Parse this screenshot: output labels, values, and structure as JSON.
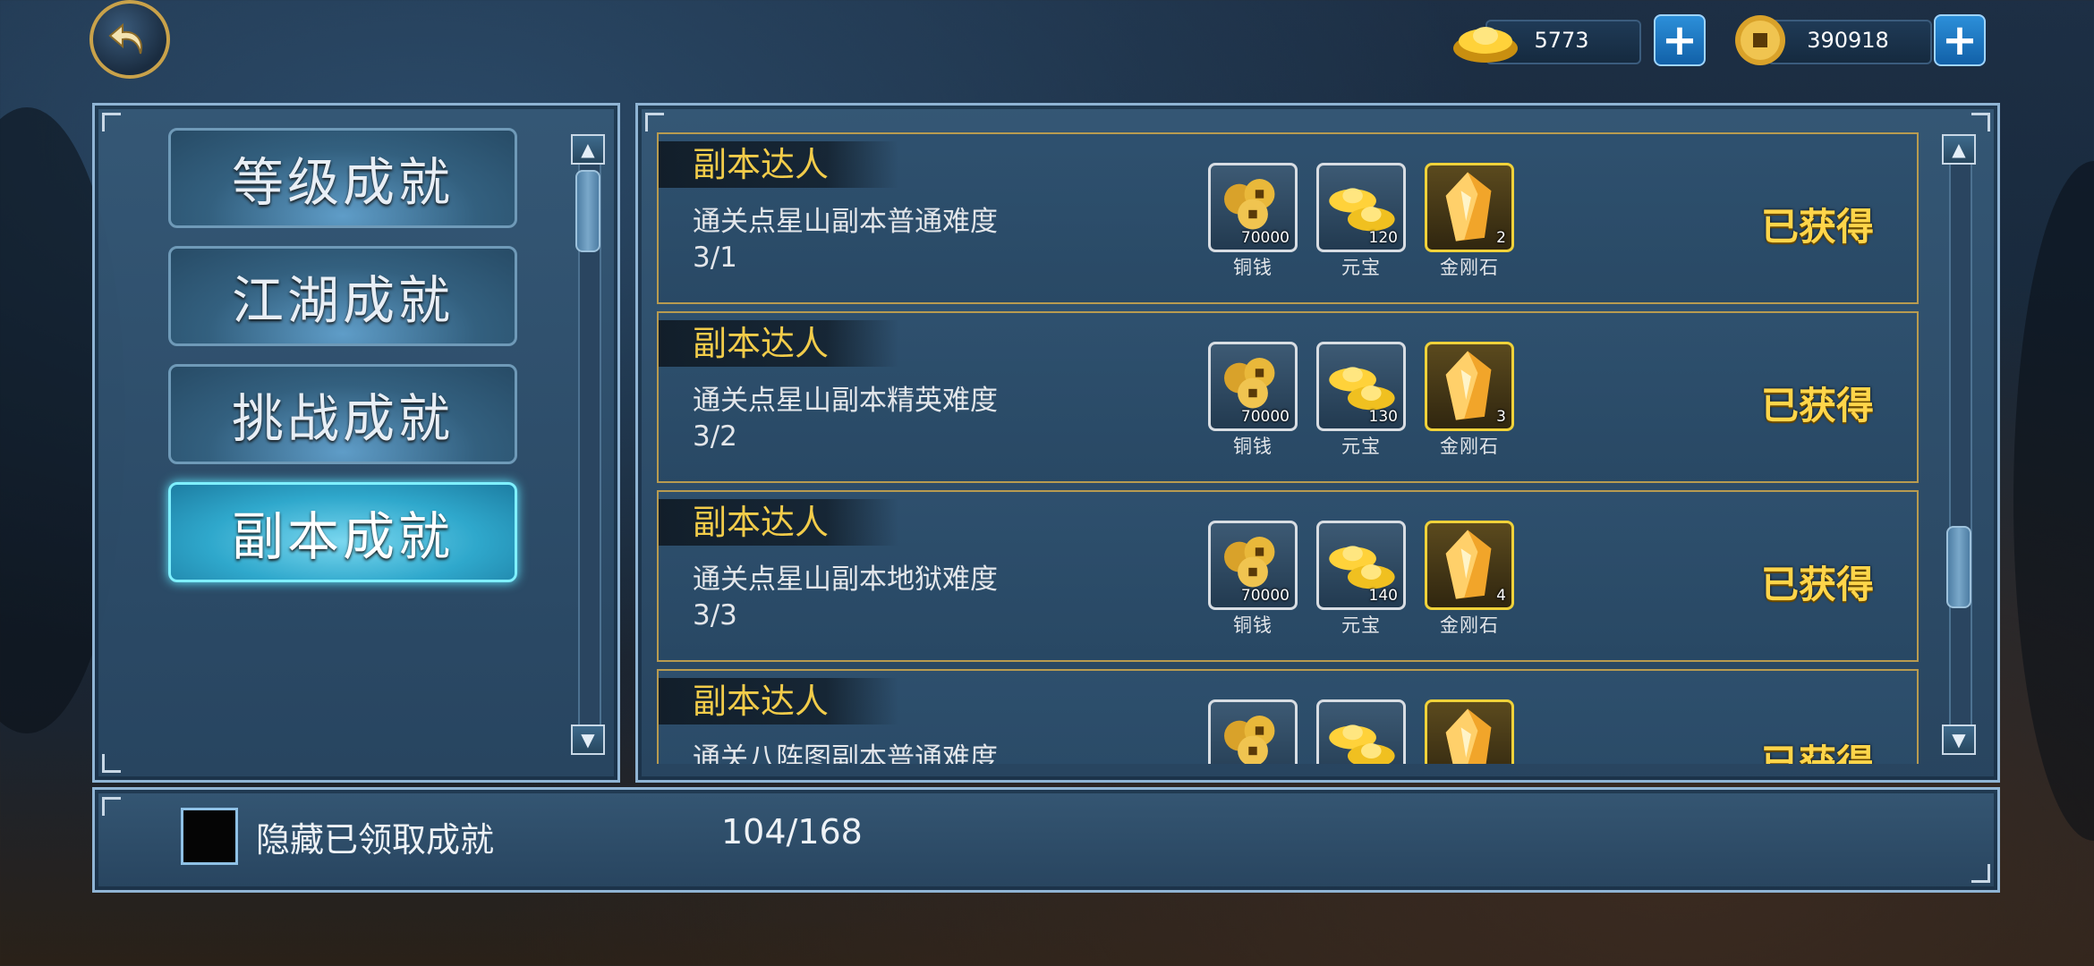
{
  "currencies": [
    {
      "name": "yuanbao",
      "icon": "gold-ingot-icon",
      "value": "5773"
    },
    {
      "name": "tongqian",
      "icon": "copper-coin-icon",
      "value": "390918"
    }
  ],
  "plus_symbol": "+",
  "tabs": [
    {
      "label": "等级成就",
      "active": false
    },
    {
      "label": "江湖成就",
      "active": false
    },
    {
      "label": "挑战成就",
      "active": false
    },
    {
      "label": "副本成就",
      "active": true
    }
  ],
  "achievements": [
    {
      "title": "副本达人",
      "desc": "通关点星山副本普通难度",
      "progress": "3/1",
      "rewards": [
        {
          "name": "铜钱",
          "qty": "70000",
          "icon": "coins-icon"
        },
        {
          "name": "元宝",
          "qty": "120",
          "icon": "gold-ingot-icon"
        },
        {
          "name": "金刚石",
          "qty": "2",
          "icon": "diamond-icon"
        }
      ],
      "status": "已获得"
    },
    {
      "title": "副本达人",
      "desc": "通关点星山副本精英难度",
      "progress": "3/2",
      "rewards": [
        {
          "name": "铜钱",
          "qty": "70000",
          "icon": "coins-icon"
        },
        {
          "name": "元宝",
          "qty": "130",
          "icon": "gold-ingot-icon"
        },
        {
          "name": "金刚石",
          "qty": "3",
          "icon": "diamond-icon"
        }
      ],
      "status": "已获得"
    },
    {
      "title": "副本达人",
      "desc": "通关点星山副本地狱难度",
      "progress": "3/3",
      "rewards": [
        {
          "name": "铜钱",
          "qty": "70000",
          "icon": "coins-icon"
        },
        {
          "name": "元宝",
          "qty": "140",
          "icon": "gold-ingot-icon"
        },
        {
          "name": "金刚石",
          "qty": "4",
          "icon": "diamond-icon"
        }
      ],
      "status": "已获得"
    },
    {
      "title": "副本达人",
      "desc": "通关八阵图副本普通难度",
      "progress": "",
      "rewards": [
        {
          "name": "铜钱",
          "qty": "",
          "icon": "coins-icon"
        },
        {
          "name": "元宝",
          "qty": "",
          "icon": "gold-ingot-icon"
        },
        {
          "name": "金刚石",
          "qty": "",
          "icon": "diamond-icon"
        }
      ],
      "status": "已获得"
    }
  ],
  "footer": {
    "hide_label": "隐藏已领取成就",
    "checked": false,
    "count": "104/168"
  },
  "colors": {
    "accent_gold": "#f2cc4a",
    "claimed": "#ffd54a",
    "active_tab": "#2fa8cc"
  }
}
